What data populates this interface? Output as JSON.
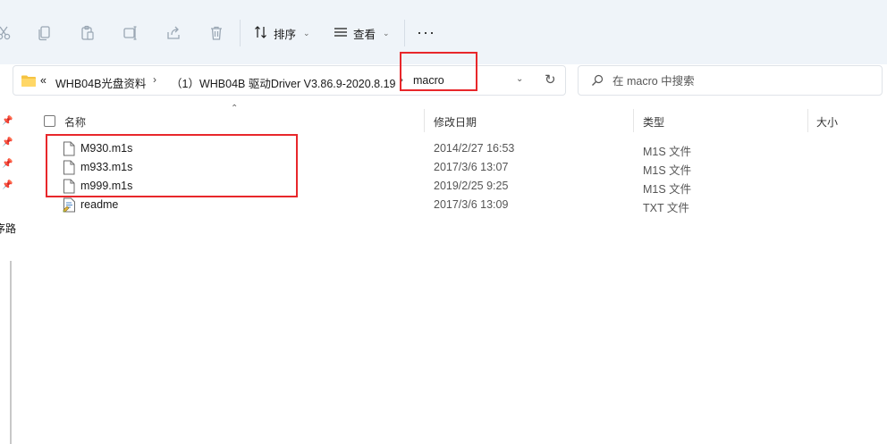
{
  "toolbar": {
    "icons": [
      "cut-icon",
      "copy-icon",
      "paste-icon",
      "rename-icon",
      "share-icon",
      "delete-icon"
    ],
    "sort_label": "排序",
    "view_label": "查看",
    "more_label": "···"
  },
  "address": {
    "prefix": "«",
    "segments": [
      "WHB04B光盘资料",
      "（1）WHB04B 驱动Driver V3.86.9-2020.8.19",
      "macro"
    ],
    "separator": "›"
  },
  "search": {
    "placeholder": "在 macro 中搜索"
  },
  "navpane": {
    "clipped_text": "序路"
  },
  "columns": {
    "name": "名称",
    "date": "修改日期",
    "type": "类型",
    "size": "大小"
  },
  "files": [
    {
      "name": "M930.m1s",
      "date": "2014/2/27 16:53",
      "type": "M1S 文件",
      "icon": "file-icon"
    },
    {
      "name": "m933.m1s",
      "date": "2017/3/6 13:07",
      "type": "M1S 文件",
      "icon": "file-icon"
    },
    {
      "name": "m999.m1s",
      "date": "2019/2/25 9:25",
      "type": "M1S 文件",
      "icon": "file-icon"
    },
    {
      "name": "readme",
      "date": "2017/3/6 13:09",
      "type": "TXT 文件",
      "icon": "text-file-icon"
    }
  ],
  "colors": {
    "toolbar_bg": "#eff4f9",
    "highlight": "#e8272b",
    "folder": "#f5c342"
  }
}
